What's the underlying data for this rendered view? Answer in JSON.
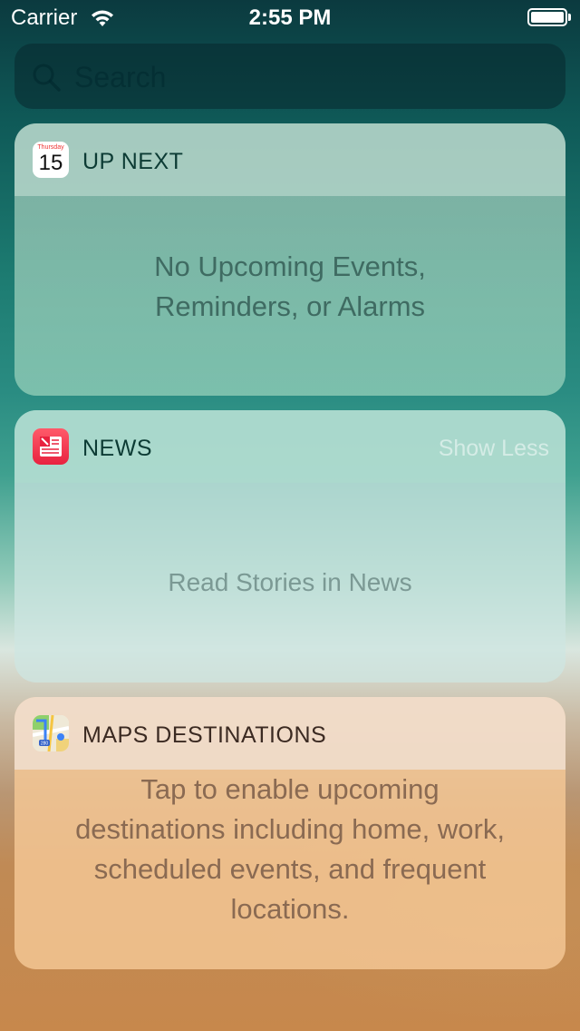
{
  "status_bar": {
    "carrier": "Carrier",
    "time": "2:55 PM"
  },
  "search": {
    "placeholder": "Search"
  },
  "widgets": {
    "up_next": {
      "title": "UP NEXT",
      "icon": "calendar-icon",
      "calendar_day": "Thursday",
      "calendar_date": "15",
      "message": "No Upcoming Events, Reminders, or Alarms"
    },
    "news": {
      "title": "NEWS",
      "icon": "news-icon",
      "action_label": "Show Less",
      "message": "Read Stories in News"
    },
    "maps": {
      "title": "MAPS DESTINATIONS",
      "icon": "maps-icon",
      "map_badge": "280",
      "message": "Tap to enable upcoming destinations including home, work, scheduled events, and frequent locations."
    }
  }
}
